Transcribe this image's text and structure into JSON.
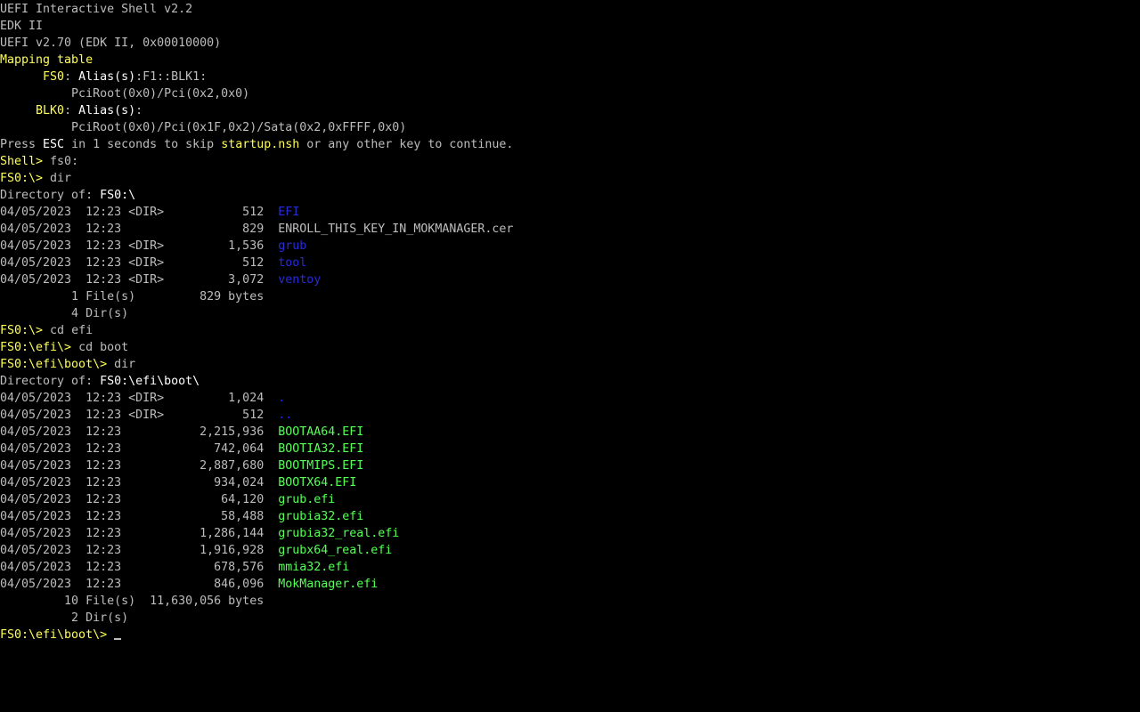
{
  "colors": {
    "gray": "#bdbdbd",
    "white": "#ffffff",
    "yellow": "#ffff55",
    "blue": "#2a2ad8",
    "green": "#55ff55",
    "background": "#000000"
  },
  "lines": [
    [
      {
        "t": "UEFI Interactive Shell v2.2",
        "c": "gray"
      }
    ],
    [
      {
        "t": "EDK II",
        "c": "gray"
      }
    ],
    [
      {
        "t": "UEFI v2.70 (EDK II, 0x00010000)",
        "c": "gray"
      }
    ],
    [
      {
        "t": "Mapping table",
        "c": "yellow"
      }
    ],
    [
      {
        "t": "      ",
        "c": "gray"
      },
      {
        "t": "FS0",
        "c": "yellow"
      },
      {
        "t": ": ",
        "c": "gray"
      },
      {
        "t": "Alias(s)",
        "c": "white"
      },
      {
        "t": ":F1::BLK1:",
        "c": "gray"
      }
    ],
    [
      {
        "t": "          PciRoot(0x0)/Pci(0x2,0x0)",
        "c": "gray"
      }
    ],
    [
      {
        "t": "     ",
        "c": "gray"
      },
      {
        "t": "BLK0",
        "c": "yellow"
      },
      {
        "t": ": ",
        "c": "gray"
      },
      {
        "t": "Alias(s)",
        "c": "white"
      },
      {
        "t": ":",
        "c": "gray"
      }
    ],
    [
      {
        "t": "          PciRoot(0x0)/Pci(0x1F,0x2)/Sata(0x2,0xFFFF,0x0)",
        "c": "gray"
      }
    ],
    [
      {
        "t": "Press ",
        "c": "gray"
      },
      {
        "t": "ESC",
        "c": "white"
      },
      {
        "t": " in 1 seconds to skip ",
        "c": "gray"
      },
      {
        "t": "startup.nsh",
        "c": "yellow"
      },
      {
        "t": " or any other key to continue.",
        "c": "gray"
      }
    ],
    [
      {
        "t": "Shell> ",
        "c": "yellow"
      },
      {
        "t": "fs0:",
        "c": "gray"
      }
    ],
    [
      {
        "t": "FS0:\\> ",
        "c": "yellow"
      },
      {
        "t": "dir",
        "c": "gray"
      }
    ],
    [
      {
        "t": "Directory of: ",
        "c": "gray"
      },
      {
        "t": "FS0:\\",
        "c": "white"
      }
    ],
    [
      {
        "t": "04/05/2023  12:23 <DIR>           512  ",
        "c": "gray"
      },
      {
        "t": "EFI",
        "c": "blue"
      }
    ],
    [
      {
        "t": "04/05/2023  12:23                 829  ",
        "c": "gray"
      },
      {
        "t": "ENROLL_THIS_KEY_IN_MOKMANAGER.cer",
        "c": "gray"
      }
    ],
    [
      {
        "t": "04/05/2023  12:23 <DIR>         1,536  ",
        "c": "gray"
      },
      {
        "t": "grub",
        "c": "blue"
      }
    ],
    [
      {
        "t": "04/05/2023  12:23 <DIR>           512  ",
        "c": "gray"
      },
      {
        "t": "tool",
        "c": "blue"
      }
    ],
    [
      {
        "t": "04/05/2023  12:23 <DIR>         3,072  ",
        "c": "gray"
      },
      {
        "t": "ventoy",
        "c": "blue"
      }
    ],
    [
      {
        "t": "          1 File(s)         829 bytes",
        "c": "gray"
      }
    ],
    [
      {
        "t": "          4 Dir(s)",
        "c": "gray"
      }
    ],
    [
      {
        "t": "FS0:\\> ",
        "c": "yellow"
      },
      {
        "t": "cd efi",
        "c": "gray"
      }
    ],
    [
      {
        "t": "FS0:\\efi\\> ",
        "c": "yellow"
      },
      {
        "t": "cd boot",
        "c": "gray"
      }
    ],
    [
      {
        "t": "FS0:\\efi\\boot\\> ",
        "c": "yellow"
      },
      {
        "t": "dir",
        "c": "gray"
      }
    ],
    [
      {
        "t": "Directory of: ",
        "c": "gray"
      },
      {
        "t": "FS0:\\efi\\boot\\",
        "c": "white"
      }
    ],
    [
      {
        "t": "04/05/2023  12:23 <DIR>         1,024  ",
        "c": "gray"
      },
      {
        "t": ".",
        "c": "blue"
      }
    ],
    [
      {
        "t": "04/05/2023  12:23 <DIR>           512  ",
        "c": "gray"
      },
      {
        "t": "..",
        "c": "blue"
      }
    ],
    [
      {
        "t": "04/05/2023  12:23           2,215,936  ",
        "c": "gray"
      },
      {
        "t": "BOOTAA64.EFI",
        "c": "green"
      }
    ],
    [
      {
        "t": "04/05/2023  12:23             742,064  ",
        "c": "gray"
      },
      {
        "t": "BOOTIA32.EFI",
        "c": "green"
      }
    ],
    [
      {
        "t": "04/05/2023  12:23           2,887,680  ",
        "c": "gray"
      },
      {
        "t": "BOOTMIPS.EFI",
        "c": "green"
      }
    ],
    [
      {
        "t": "04/05/2023  12:23             934,024  ",
        "c": "gray"
      },
      {
        "t": "BOOTX64.EFI",
        "c": "green"
      }
    ],
    [
      {
        "t": "04/05/2023  12:23              64,120  ",
        "c": "gray"
      },
      {
        "t": "grub.efi",
        "c": "green"
      }
    ],
    [
      {
        "t": "04/05/2023  12:23              58,488  ",
        "c": "gray"
      },
      {
        "t": "grubia32.efi",
        "c": "green"
      }
    ],
    [
      {
        "t": "04/05/2023  12:23           1,286,144  ",
        "c": "gray"
      },
      {
        "t": "grubia32_real.efi",
        "c": "green"
      }
    ],
    [
      {
        "t": "04/05/2023  12:23           1,916,928  ",
        "c": "gray"
      },
      {
        "t": "grubx64_real.efi",
        "c": "green"
      }
    ],
    [
      {
        "t": "04/05/2023  12:23             678,576  ",
        "c": "gray"
      },
      {
        "t": "mmia32.efi",
        "c": "green"
      }
    ],
    [
      {
        "t": "04/05/2023  12:23             846,096  ",
        "c": "gray"
      },
      {
        "t": "MokManager.efi",
        "c": "green"
      }
    ],
    [
      {
        "t": "         10 File(s)  11,630,056 bytes",
        "c": "gray"
      }
    ],
    [
      {
        "t": "          2 Dir(s)",
        "c": "gray"
      }
    ],
    [
      {
        "t": "FS0:\\efi\\boot\\> ",
        "c": "yellow"
      }
    ]
  ],
  "cursor_icon": "block-underscore-cursor"
}
